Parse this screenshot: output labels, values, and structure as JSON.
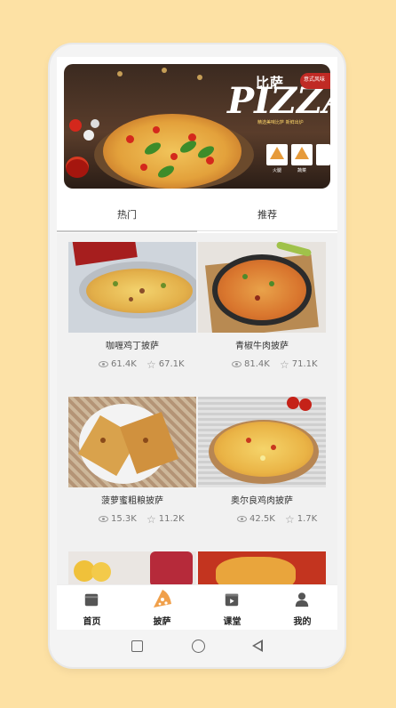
{
  "banner": {
    "title_cn": "比萨",
    "title_en": "PIZZA",
    "badge_text": "意式风味",
    "subtitle": "精选美味比萨 新鲜出炉",
    "card_labels": [
      "火腿",
      "蔬菜",
      ""
    ]
  },
  "tabs": [
    {
      "label": "热门",
      "active": true
    },
    {
      "label": "推荐",
      "active": false
    }
  ],
  "items": [
    {
      "name": "咖喱鸡丁披萨",
      "views": "61.4K",
      "likes": "67.1K"
    },
    {
      "name": "青椒牛肉披萨",
      "views": "81.4K",
      "likes": "71.1K"
    },
    {
      "name": "菠萝蜜粗粮披萨",
      "views": "15.3K",
      "likes": "11.2K"
    },
    {
      "name": "奥尔良鸡肉披萨",
      "views": "42.5K",
      "likes": "1.7K"
    }
  ],
  "nav": [
    {
      "label": "首页",
      "icon": "store-icon"
    },
    {
      "label": "披萨",
      "icon": "pizza-slice-icon"
    },
    {
      "label": "课堂",
      "icon": "video-icon"
    },
    {
      "label": "我的",
      "icon": "person-icon"
    }
  ],
  "colors": {
    "background": "#fde1a4",
    "accent": "#f0a04b",
    "nav_icon": "#555555"
  }
}
